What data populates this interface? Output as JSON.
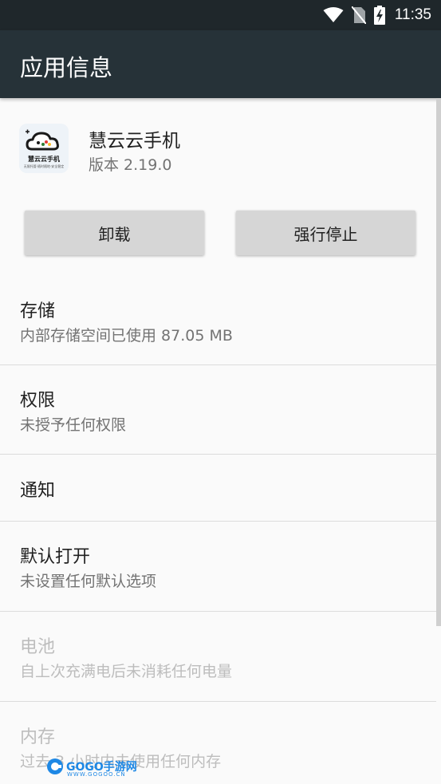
{
  "status_bar": {
    "time": "11:35",
    "icons": [
      "wifi-icon",
      "no-sim-icon",
      "battery-charging-icon"
    ]
  },
  "app_bar": {
    "title": "应用信息"
  },
  "app": {
    "name": "慧云云手机",
    "version": "版本 2.19.0",
    "icon_text": "慧云云手机",
    "icon_subtext": "无限托管·随时随地·安全稳定"
  },
  "buttons": {
    "uninstall": "卸载",
    "force_stop": "强行停止"
  },
  "items": [
    {
      "title": "存储",
      "subtitle": "内部存储空间已使用 87.05 MB",
      "enabled": true
    },
    {
      "title": "权限",
      "subtitle": "未授予任何权限",
      "enabled": true
    },
    {
      "title": "通知",
      "subtitle": "",
      "enabled": true
    },
    {
      "title": "默认打开",
      "subtitle": "未设置任何默认选项",
      "enabled": true
    },
    {
      "title": "电池",
      "subtitle": "自上次充满电后未消耗任何电量",
      "enabled": false
    },
    {
      "title": "内存",
      "subtitle": "过去 3 小时内未使用任何内存",
      "enabled": false
    }
  ],
  "watermark": {
    "logo_text": "GOGO手游网",
    "url": "WWW.GOGOO.CN"
  },
  "colors": {
    "status_bar": "#1f272b",
    "app_bar": "#263238",
    "background": "#fafafa",
    "button": "#d6d6d6",
    "disabled_text": "#bdbdbd"
  }
}
